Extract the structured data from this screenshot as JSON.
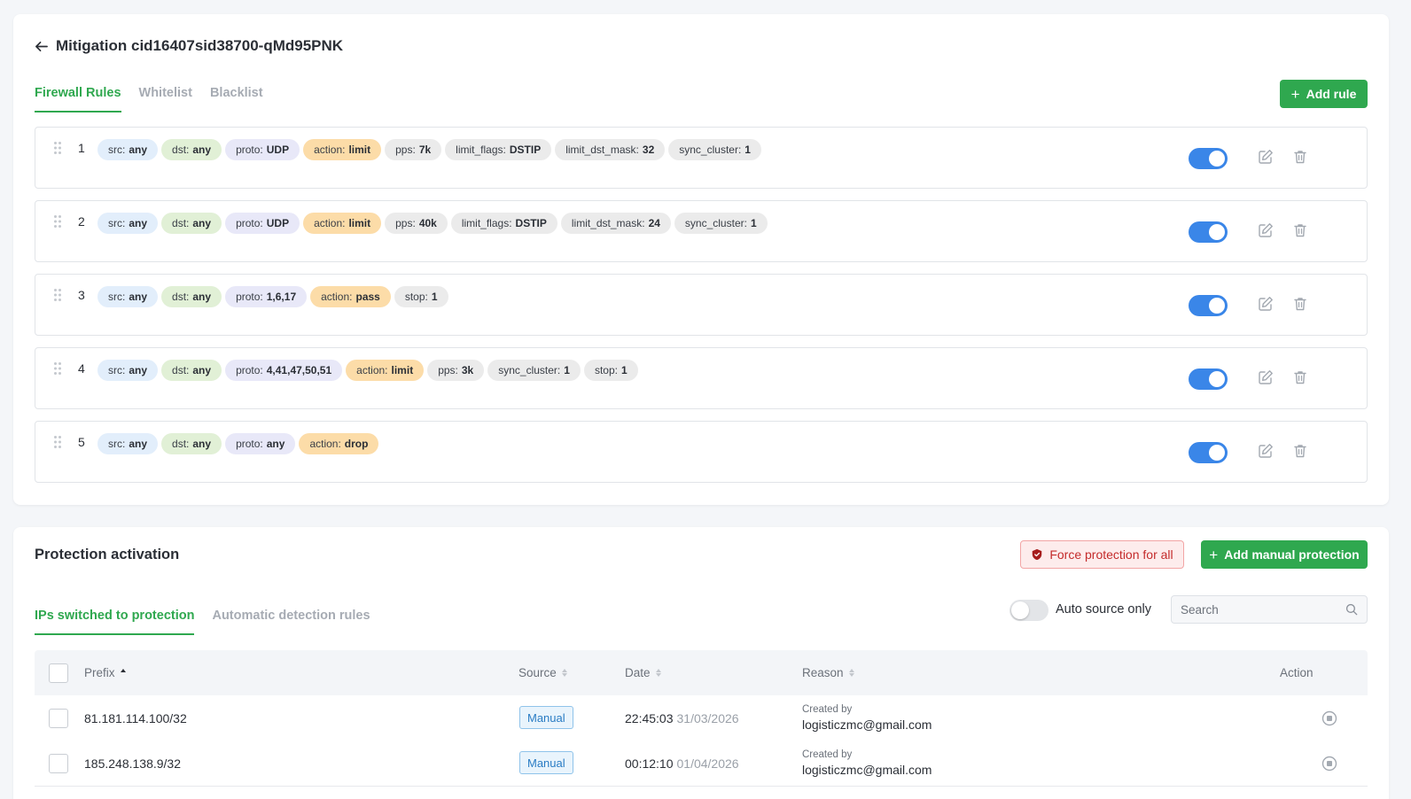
{
  "header": {
    "title": "Mitigation cid16407sid38700-qMd95PNK"
  },
  "firewall": {
    "tabs": [
      {
        "label": "Firewall Rules",
        "active": true
      },
      {
        "label": "Whitelist",
        "active": false
      },
      {
        "label": "Blacklist",
        "active": false
      }
    ],
    "add_rule_label": "Add rule",
    "rules": [
      {
        "num": "1",
        "enabled": true,
        "chips": [
          {
            "key": "src:",
            "val": "any",
            "kind": "src"
          },
          {
            "key": "dst:",
            "val": "any",
            "kind": "dst"
          },
          {
            "key": "proto:",
            "val": "UDP",
            "kind": "proto"
          },
          {
            "key": "action:",
            "val": "limit",
            "kind": "action"
          },
          {
            "key": "pps:",
            "val": "7k",
            "kind": "other"
          },
          {
            "key": "limit_flags:",
            "val": "DSTIP",
            "kind": "other"
          },
          {
            "key": "limit_dst_mask:",
            "val": "32",
            "kind": "other"
          },
          {
            "key": "sync_cluster:",
            "val": "1",
            "kind": "other"
          }
        ]
      },
      {
        "num": "2",
        "enabled": true,
        "chips": [
          {
            "key": "src:",
            "val": "any",
            "kind": "src"
          },
          {
            "key": "dst:",
            "val": "any",
            "kind": "dst"
          },
          {
            "key": "proto:",
            "val": "UDP",
            "kind": "proto"
          },
          {
            "key": "action:",
            "val": "limit",
            "kind": "action"
          },
          {
            "key": "pps:",
            "val": "40k",
            "kind": "other"
          },
          {
            "key": "limit_flags:",
            "val": "DSTIP",
            "kind": "other"
          },
          {
            "key": "limit_dst_mask:",
            "val": "24",
            "kind": "other"
          },
          {
            "key": "sync_cluster:",
            "val": "1",
            "kind": "other"
          }
        ]
      },
      {
        "num": "3",
        "enabled": true,
        "chips": [
          {
            "key": "src:",
            "val": "any",
            "kind": "src"
          },
          {
            "key": "dst:",
            "val": "any",
            "kind": "dst"
          },
          {
            "key": "proto:",
            "val": "1,6,17",
            "kind": "proto"
          },
          {
            "key": "action:",
            "val": "pass",
            "kind": "action"
          },
          {
            "key": "stop:",
            "val": "1",
            "kind": "other"
          }
        ]
      },
      {
        "num": "4",
        "enabled": true,
        "chips": [
          {
            "key": "src:",
            "val": "any",
            "kind": "src"
          },
          {
            "key": "dst:",
            "val": "any",
            "kind": "dst"
          },
          {
            "key": "proto:",
            "val": "4,41,47,50,51",
            "kind": "proto"
          },
          {
            "key": "action:",
            "val": "limit",
            "kind": "action"
          },
          {
            "key": "pps:",
            "val": "3k",
            "kind": "other"
          },
          {
            "key": "sync_cluster:",
            "val": "1",
            "kind": "other"
          },
          {
            "key": "stop:",
            "val": "1",
            "kind": "other"
          }
        ]
      },
      {
        "num": "5",
        "enabled": true,
        "chips": [
          {
            "key": "src:",
            "val": "any",
            "kind": "src"
          },
          {
            "key": "dst:",
            "val": "any",
            "kind": "dst"
          },
          {
            "key": "proto:",
            "val": "any",
            "kind": "proto"
          },
          {
            "key": "action:",
            "val": "drop",
            "kind": "action"
          }
        ]
      }
    ]
  },
  "protection": {
    "title": "Protection activation",
    "force_label": "Force protection for all",
    "add_manual_label": "Add manual protection",
    "tabs": [
      {
        "label": "IPs switched to protection",
        "active": true
      },
      {
        "label": "Automatic detection rules",
        "active": false
      }
    ],
    "auto_source_label": "Auto source only",
    "auto_source_enabled": false,
    "search_placeholder": "Search",
    "columns": {
      "prefix": "Prefix",
      "source": "Source",
      "date": "Date",
      "reason": "Reason",
      "action": "Action"
    },
    "rows": [
      {
        "prefix": "81.181.114.100/32",
        "source": "Manual",
        "time": "22:45:03",
        "date": "31/03/2026",
        "reason_label": "Created by",
        "reason_value": "logisticzmc@gmail.com"
      },
      {
        "prefix": "185.248.138.9/32",
        "source": "Manual",
        "time": "00:12:10",
        "date": "01/04/2026",
        "reason_label": "Created by",
        "reason_value": "logisticzmc@gmail.com"
      }
    ]
  },
  "colors": {
    "accent": "#2fa84f",
    "toggle_on": "#3a86e8",
    "danger": "#c42b2b"
  }
}
